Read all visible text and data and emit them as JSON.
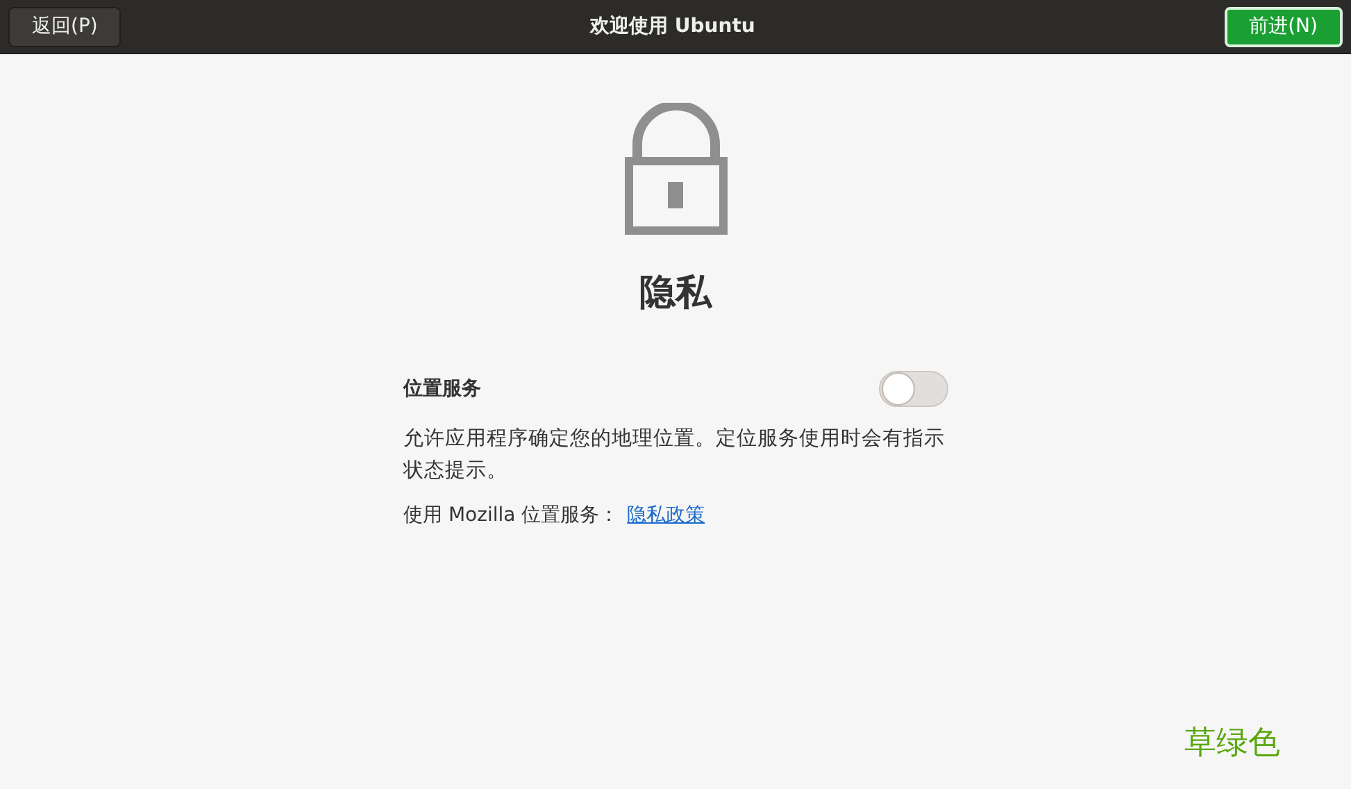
{
  "header": {
    "back_button": "返回(P)",
    "title": "欢迎使用 Ubuntu",
    "next_button": "前进(N)"
  },
  "page": {
    "heading": "隐私",
    "location_setting": {
      "label": "位置服务",
      "on": false
    },
    "description": "允许应用程序确定您的地理位置。定位服务使用时会有指示状态提示。",
    "provider_text": "使用 Mozilla 位置服务：",
    "policy_link": "隐私政策"
  },
  "annotation": "草绿色"
}
